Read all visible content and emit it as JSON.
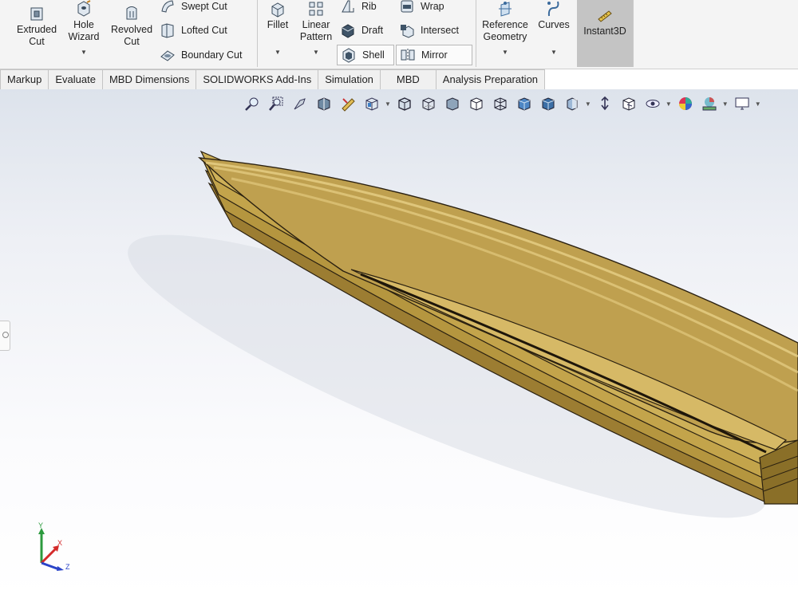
{
  "ribbon": {
    "extruded_cut": "Extruded\nCut",
    "hole_wizard": "Hole\nWizard",
    "revolved_cut": "Revolved\nCut",
    "swept_cut": "Swept Cut",
    "lofted_cut": "Lofted Cut",
    "boundary_cut": "Boundary Cut",
    "fillet": "Fillet",
    "linear_pattern": "Linear\nPattern",
    "rib": "Rib",
    "draft": "Draft",
    "shell": "Shell",
    "wrap": "Wrap",
    "intersect": "Intersect",
    "mirror": "Mirror",
    "reference_geometry": "Reference\nGeometry",
    "curves": "Curves",
    "instant3d": "Instant3D"
  },
  "tabs": [
    "Markup",
    "Evaluate",
    "MBD Dimensions",
    "SOLIDWORKS Add-Ins",
    "Simulation",
    "MBD",
    "Analysis Preparation"
  ],
  "triad": {
    "x": "X",
    "y": "Y",
    "z": "Z"
  },
  "colors": {
    "part": "#bfa04f",
    "part_dark": "#8a6f28",
    "edge": "#2a2010",
    "active_tool": "#c4c4c4"
  }
}
